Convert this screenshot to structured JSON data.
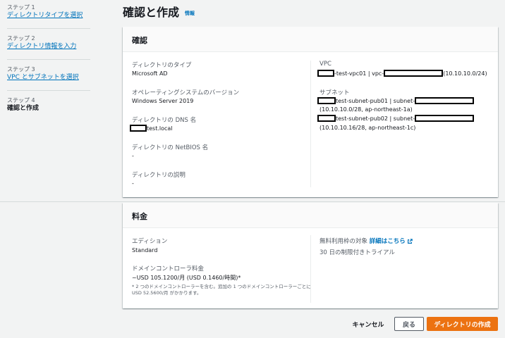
{
  "wizard": {
    "steps": [
      {
        "number": "ステップ 1",
        "label": "ディレクトリタイプを選択"
      },
      {
        "number": "ステップ 2",
        "label": "ディレクトリ情報を入力"
      },
      {
        "number": "ステップ 3",
        "label": "VPC とサブネットを選択"
      },
      {
        "number": "ステップ 4",
        "label": "確認と作成"
      }
    ]
  },
  "page": {
    "title": "確認と作成",
    "info_link": "情報"
  },
  "review": {
    "header": "確認",
    "directory_type": {
      "label": "ディレクトリのタイプ",
      "value": "Microsoft AD"
    },
    "os_version": {
      "label": "オペレーティングシステムのバージョン",
      "value": "Windows Server 2019"
    },
    "dns_name": {
      "label": "ディレクトリの DNS 名",
      "value": "test.local"
    },
    "netbios": {
      "label": "ディレクトリの NetBIOS 名",
      "value": "-"
    },
    "description": {
      "label": "ディレクトリの説明",
      "value": "-"
    },
    "vpc": {
      "label": "VPC",
      "name_part": "-test-vpc01 | vpc-",
      "cidr": "(10.10.10.0/24)"
    },
    "subnets": {
      "label": "サブネット",
      "items": [
        {
          "name_part": "test-subnet-pub01 | subnet-",
          "detail": "(10.10.10.0/28, ap-northeast-1a)"
        },
        {
          "name_part": "test-subnet-pub02 | subnet-",
          "detail": "(10.10.10.16/28, ap-northeast-1c)"
        }
      ]
    }
  },
  "pricing": {
    "header": "料金",
    "edition": {
      "label": "エディション",
      "value": "Standard"
    },
    "dc_price": {
      "label": "ドメインコントローラ料金",
      "value": "~USD 105.1200/月 (USD 0.1460/時間)*",
      "note": "* 2 つのドメインコントローラーを含む。追加の 1 つのドメインコントローラーごとに USD 52.5600/月 がかかります。"
    },
    "free_tier": {
      "label": "無料利用枠の対象",
      "link": "詳細はこちら",
      "value": "30 日の制限付きトライアル"
    }
  },
  "actions": {
    "cancel": "キャンセル",
    "back": "戻る",
    "create": "ディレクトリの作成"
  }
}
